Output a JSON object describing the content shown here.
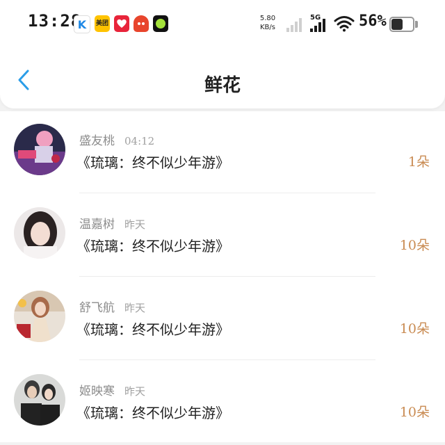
{
  "status_bar": {
    "time": "13:28",
    "net_speed_value": "5.80",
    "net_speed_unit": "KB/s",
    "network_type": "5G",
    "battery_percent": "56%",
    "battery_level": 0.56,
    "app_icons": [
      {
        "name": "k-app-icon",
        "label": "K"
      },
      {
        "name": "meituan-app-icon",
        "label": "美团"
      },
      {
        "name": "red-app-icon",
        "label": ""
      },
      {
        "name": "orange-app-icon",
        "label": ""
      },
      {
        "name": "green-dot-app-icon",
        "label": ""
      }
    ]
  },
  "nav": {
    "back_icon": "chevron-left-icon",
    "title": "鲜花"
  },
  "colors": {
    "accent_blue": "#2a9de8",
    "count_orange": "#c98b52",
    "name_gray": "#8c8c8c"
  },
  "items": [
    {
      "name": "盛友桃",
      "time": "04:12",
      "message": "《琉璃：终不似少年游》",
      "count": "1朵"
    },
    {
      "name": "温嘉树",
      "time": "昨天",
      "message": "《琉璃：终不似少年游》",
      "count": "10朵"
    },
    {
      "name": "舒飞航",
      "time": "昨天",
      "message": "《琉璃：终不似少年游》",
      "count": "10朵"
    },
    {
      "name": "姬映寒",
      "time": "昨天",
      "message": "《琉璃：终不似少年游》",
      "count": "10朵"
    }
  ]
}
